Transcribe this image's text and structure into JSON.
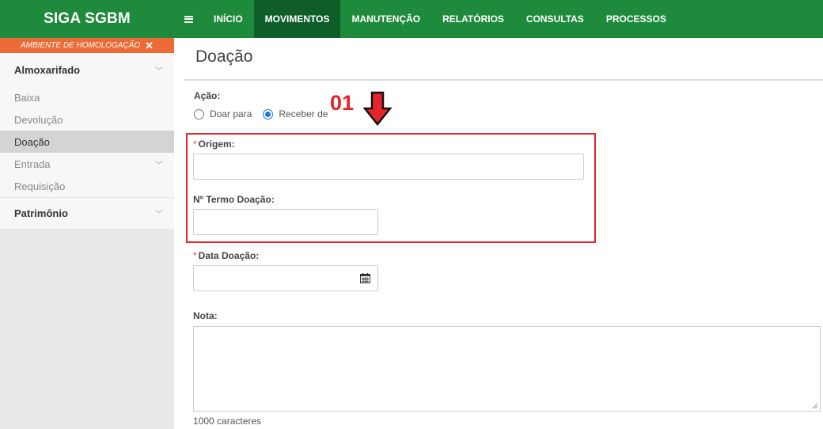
{
  "app": {
    "brand": "SIGA SGBM"
  },
  "topnav": {
    "items": [
      {
        "label": "INÍCIO"
      },
      {
        "label": "MOVIMENTOS"
      },
      {
        "label": "MANUTENÇÃO"
      },
      {
        "label": "RELATÓRIOS"
      },
      {
        "label": "CONSULTAS"
      },
      {
        "label": "PROCESSOS"
      }
    ],
    "active": "MOVIMENTOS"
  },
  "sidebar": {
    "env_banner": "AMBIENTE DE HOMOLOGAÇÃO",
    "sections": [
      {
        "label": "Almoxarifado",
        "icon": "chevron-down-icon"
      },
      {
        "label": "Patrimônio",
        "icon": "chevron-down-icon"
      }
    ],
    "items": [
      {
        "label": "Baixa"
      },
      {
        "label": "Devolução"
      },
      {
        "label": "Doação",
        "active": true
      },
      {
        "label": "Entrada",
        "icon": "chevron-down-icon"
      },
      {
        "label": "Requisição"
      }
    ]
  },
  "page": {
    "title": "Doação",
    "annotation": "01",
    "form": {
      "acao_label": "Ação:",
      "options": [
        {
          "label": "Doar para",
          "checked": false
        },
        {
          "label": "Receber de",
          "checked": true
        }
      ],
      "required_mark": "*",
      "origem_label": "Origem:",
      "origem_value": "",
      "termo_label": "Nº Termo Doação:",
      "termo_value": "",
      "data_label": "Data Doação:",
      "data_value": "",
      "nota_label": "Nota:",
      "nota_value": "",
      "counter": "1000 caracteres"
    }
  },
  "colors": {
    "topbar": "#1e8a3c",
    "topbar_active": "#0f5e2a",
    "env_banner": "#ec6a35",
    "annotation": "#e5242b",
    "radio_checked": "#1a73e8"
  }
}
